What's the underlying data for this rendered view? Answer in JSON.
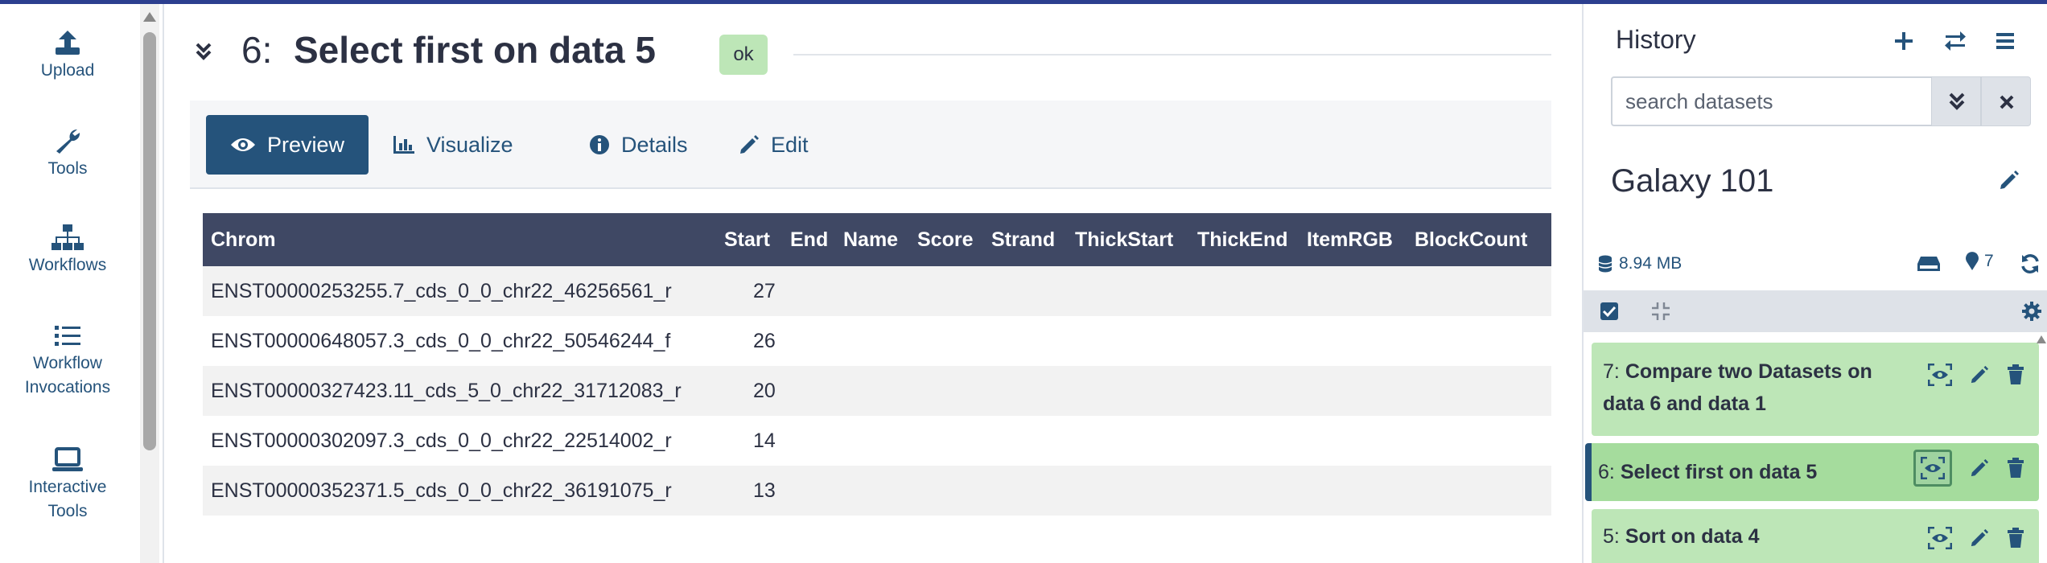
{
  "activity_bar": {
    "items": [
      {
        "label": "Upload"
      },
      {
        "label": "Tools"
      },
      {
        "label": "Workflows"
      },
      {
        "label": "Workflow Invocations",
        "line1": "Workflow",
        "line2": "Invocations"
      },
      {
        "label": "Interactive Tools",
        "line1": "Interactive",
        "line2": "Tools"
      }
    ]
  },
  "dataset": {
    "number": "6:",
    "title": "Select first on data 5",
    "state": "ok"
  },
  "tabs": [
    {
      "label": "Preview",
      "icon": "eye-icon",
      "active": true
    },
    {
      "label": "Visualize",
      "icon": "chart-bar-icon"
    },
    {
      "label": "Details",
      "icon": "info-circle-icon"
    },
    {
      "label": "Edit",
      "icon": "pencil-icon"
    }
  ],
  "table": {
    "columns": [
      "Chrom",
      "Start",
      "End",
      "Name",
      "Score",
      "Strand",
      "ThickStart",
      "ThickEnd",
      "ItemRGB",
      "BlockCount"
    ],
    "rows": [
      {
        "chrom": "ENST00000253255.7_cds_0_0_chr22_46256561_r",
        "start": "27"
      },
      {
        "chrom": "ENST00000648057.3_cds_0_0_chr22_50546244_f",
        "start": "26"
      },
      {
        "chrom": "ENST00000327423.11_cds_5_0_chr22_31712083_r",
        "start": "20"
      },
      {
        "chrom": "ENST00000302097.3_cds_0_0_chr22_22514002_r",
        "start": "14"
      },
      {
        "chrom": "ENST00000352371.5_cds_0_0_chr22_36191075_r",
        "start": "13"
      }
    ]
  },
  "history": {
    "title": "History",
    "search_placeholder": "search datasets",
    "name": "Galaxy 101",
    "size": "8.94 MB",
    "tag_count": "7",
    "items": [
      {
        "hid": "7:",
        "name_line1": "Compare two Datasets on",
        "name_line2": "data 6 and data 1"
      },
      {
        "hid": "6:",
        "name": "Select first on data 5",
        "current": true
      },
      {
        "hid": "5:",
        "name": "Sort on data 4"
      }
    ]
  },
  "colors": {
    "primary": "#25537b",
    "table_header": "#3f4864",
    "ok_green": "#bde6b7",
    "top_bar": "#2c3f8f"
  }
}
